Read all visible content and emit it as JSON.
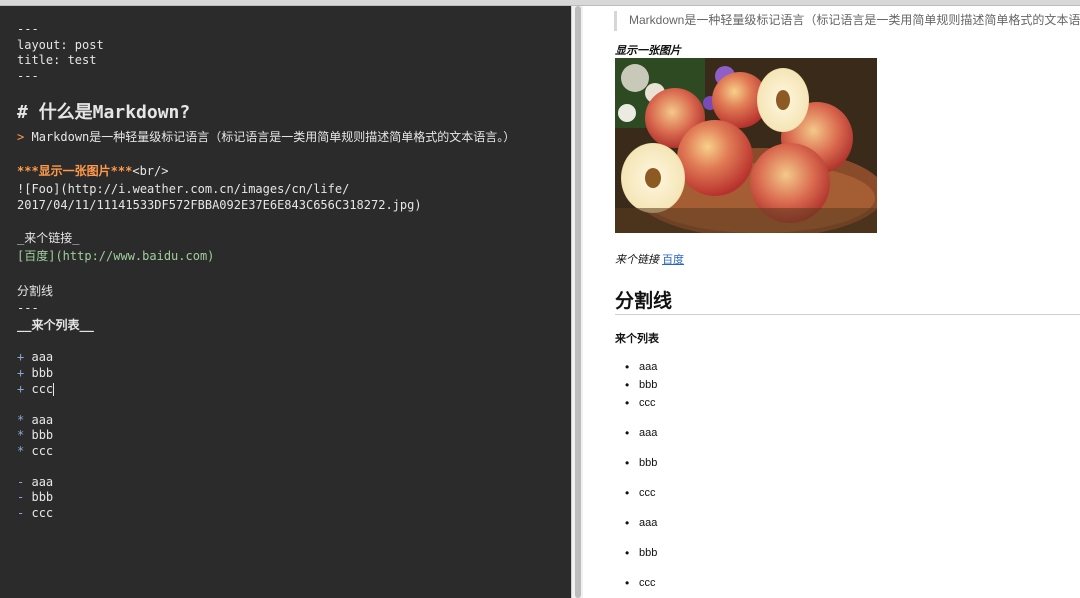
{
  "editor": {
    "front_matter": {
      "open": "---",
      "layout": "layout: post",
      "title": "title: test",
      "close": "---"
    },
    "heading_mark": "#",
    "heading_text": "什么是Markdown?",
    "quote_mark": ">",
    "quote_text": "Markdown是一种轻量级标记语言（标记语言是一类用简单规则描述简单格式的文本语言。）",
    "bold_open": "***显示一张图片***",
    "br_tag": "<br/>",
    "image_line1": "![Foo](http://i.weather.com.cn/images/cn/life/",
    "image_line2": "2017/04/11/11141533DF572FBBA092E37E6E843C656C318272.jpg)",
    "italic_link_label": "_来个链接_",
    "link_text": "[百度]",
    "link_url": "(http://www.baidu.com)",
    "section_text": "分割线",
    "rule": "---",
    "bold_list_label": "__来个列表__",
    "list_plus": [
      {
        "marker": "+",
        "text": "aaa"
      },
      {
        "marker": "+",
        "text": "bbb"
      },
      {
        "marker": "+",
        "text": "ccc"
      }
    ],
    "list_star": [
      {
        "marker": "*",
        "text": "aaa"
      },
      {
        "marker": "*",
        "text": "bbb"
      },
      {
        "marker": "*",
        "text": "ccc"
      }
    ],
    "list_dash": [
      {
        "marker": "-",
        "text": "aaa"
      },
      {
        "marker": "-",
        "text": "bbb"
      },
      {
        "marker": "-",
        "text": "ccc"
      }
    ]
  },
  "preview": {
    "blockquote": "Markdown是一种轻量级标记语言（标记语言是一类用简单规则描述简单格式的文本语言。）",
    "image_caption": "显示一张图片",
    "link_prefix": "来个链接",
    "link_label": "百度",
    "heading2": "分割线",
    "strong_text": "来个列表",
    "list_items": [
      "aaa",
      "bbb",
      "ccc",
      "aaa",
      "bbb",
      "ccc",
      "aaa",
      "bbb",
      "ccc"
    ]
  },
  "colors": {
    "editor_bg": "#2b2b2b",
    "heading": "#7fc7c6",
    "accent_orange": "#ff9a4a",
    "link_purple": "#d8a6d3",
    "url_green": "#9fcf9a",
    "italic_yellow": "#f0b94a",
    "bullet_blue": "#8aa8d6",
    "preview_link": "#2a64c5"
  }
}
